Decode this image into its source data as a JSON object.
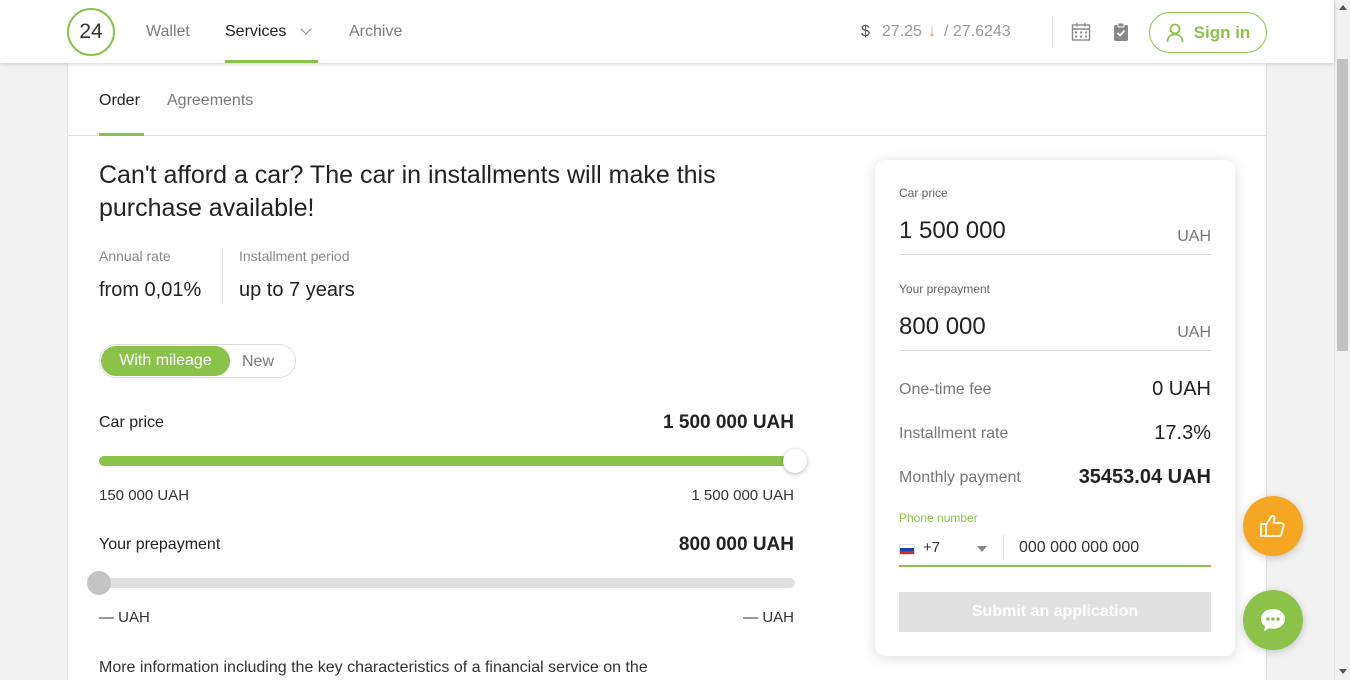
{
  "header": {
    "logo": "24",
    "nav": [
      {
        "label": "Wallet",
        "active": false
      },
      {
        "label": "Services",
        "active": true
      },
      {
        "label": "Archive",
        "active": false
      }
    ],
    "rate": {
      "currency": "$",
      "buy": "27.25",
      "trend_arrow": "↓",
      "sell": "/ 27.6243"
    },
    "icons": [
      "calendar-icon",
      "clipboard-check-icon",
      "user-icon"
    ],
    "signin_label": "Sign in",
    "accent_color": "#8bc34a"
  },
  "subtabs": [
    {
      "label": "Order",
      "active": true
    },
    {
      "label": "Agreements",
      "active": false
    }
  ],
  "main": {
    "title": "Can't afford a car? The car in installments will make this purchase available!",
    "annual_rate": {
      "label": "Annual rate",
      "value": "from 0,01%"
    },
    "period": {
      "label": "Installment period",
      "value": "up to 7 years"
    },
    "toggle": {
      "selected": "With mileage",
      "other": "New"
    },
    "car_price": {
      "label": "Car price",
      "value": "1 500 000 UAH",
      "min": "150 000 UAH",
      "max": "1 500 000 UAH",
      "position_fraction": 1.0
    },
    "prepayment": {
      "label": "Your prepayment",
      "value": "800 000 UAH",
      "min": "— UAH",
      "max": "— UAH",
      "position_fraction": 0.0
    },
    "more_info": "More information including the key characteristics of a financial service on the"
  },
  "panel": {
    "car_price_label": "Car price",
    "car_price_value": "1 500 000",
    "car_price_unit": "UAH",
    "prepayment_label": "Your prepayment",
    "prepayment_value": "800 000",
    "prepayment_unit": "UAH",
    "fee_label": "One-time fee",
    "fee_value": "0 UAH",
    "rate_label": "Installment rate",
    "rate_value": "17.3%",
    "monthly_label": "Monthly payment",
    "monthly_value": "35453.04 UAH",
    "phone_label": "Phone number",
    "phone_code": "+7",
    "phone_placeholder": "000 000 000 000",
    "submit_label": "Submit an application"
  },
  "fabs": [
    "thumbs-up-icon",
    "chat-icon"
  ],
  "colors": {
    "accent": "#8bc34a",
    "orange": "#f5a623",
    "rate_down": "#f08a7a"
  }
}
